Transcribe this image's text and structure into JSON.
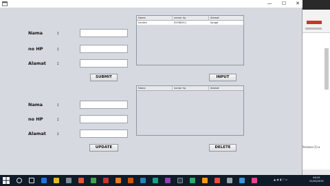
{
  "form_top": {
    "labels": {
      "nama": "Nama",
      "nohp": "no HP",
      "alamat": "Alamat"
    },
    "colon": ":",
    "submit_label": "SUBMIT"
  },
  "form_bottom": {
    "labels": {
      "nama": "Nama",
      "nohp": "no HP",
      "alamat": "Alamat"
    },
    "colon": ":",
    "update_label": "UPDATE"
  },
  "table_top": {
    "columns": [
      "Nama",
      "nomor hp",
      "Alamat"
    ],
    "rows": [
      [
        "hendra",
        "02938311",
        "lorogo"
      ]
    ]
  },
  "input_label": "INPUT",
  "table_bottom": {
    "columns": [
      "Nama",
      "nomor hp",
      "Alamat"
    ]
  },
  "delete_label": "DELETE",
  "window_controls": {
    "minimize": "—",
    "maximize": "☐",
    "close": "✕"
  },
  "background_app": {
    "text": "Persona (1) ▾"
  },
  "clock": {
    "time": "06:35",
    "date": "21/03/2015"
  },
  "colors": {
    "window_bg": "#d6d9df",
    "taskbar": "#0f1b29",
    "desktop": "#2b5f86"
  }
}
